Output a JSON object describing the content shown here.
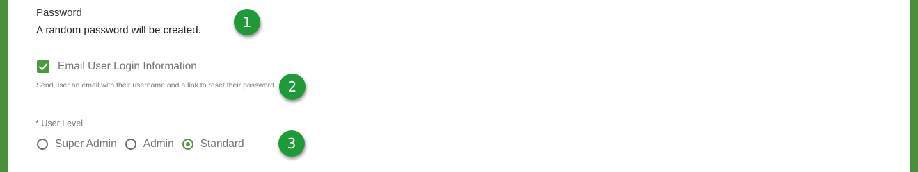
{
  "password": {
    "label": "Password",
    "value": "A random password will be created."
  },
  "email_login": {
    "label": "Email User Login Information",
    "checked": true,
    "help": "Send user an email with their username and a link to reset their password"
  },
  "user_level": {
    "label": "* User Level",
    "options": [
      {
        "label": "Super Admin",
        "selected": false
      },
      {
        "label": "Admin",
        "selected": false
      },
      {
        "label": "Standard",
        "selected": true
      }
    ]
  },
  "callouts": [
    "1",
    "2",
    "3"
  ],
  "colors": {
    "accent": "#4a9a3b",
    "callout": "#1f9a38",
    "frame": "#4a8f3c"
  },
  "icons": {
    "checkbox": "checkmark-icon"
  }
}
